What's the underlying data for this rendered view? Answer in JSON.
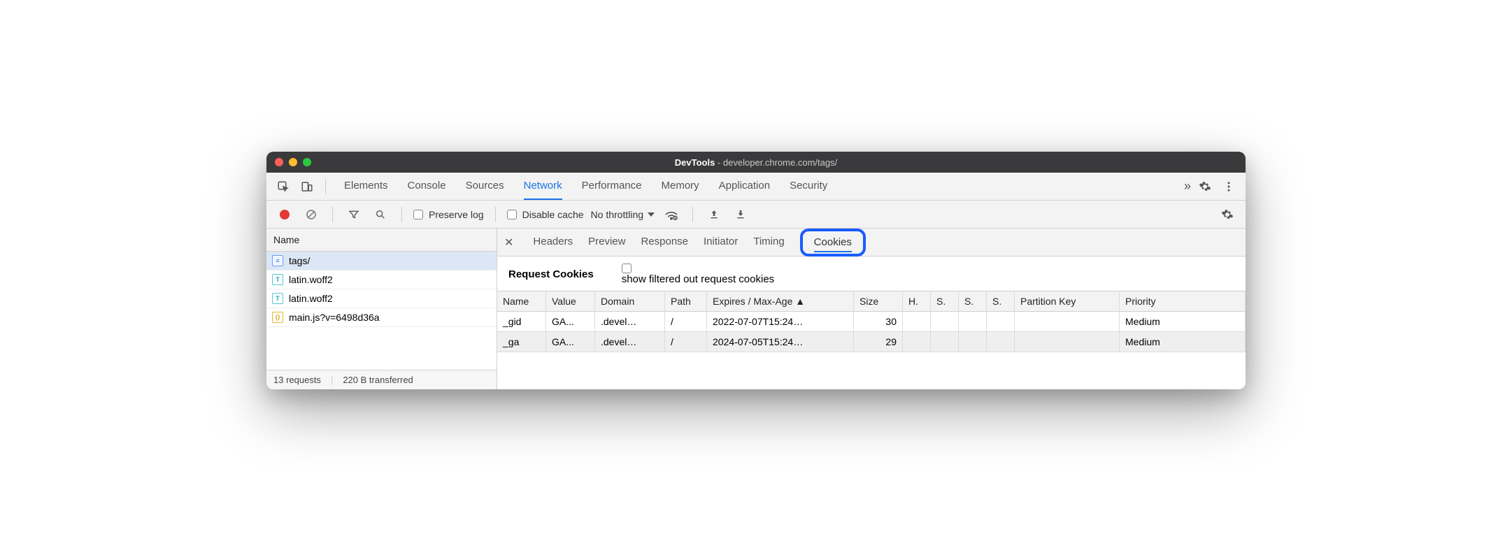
{
  "window": {
    "title_prefix": "DevTools",
    "title_url": "developer.chrome.com/tags/"
  },
  "main_tabs": [
    "Elements",
    "Console",
    "Sources",
    "Network",
    "Performance",
    "Memory",
    "Application",
    "Security"
  ],
  "main_tab_active": "Network",
  "toolbar": {
    "preserve_log": "Preserve log",
    "disable_cache": "Disable cache",
    "throttling": "No throttling"
  },
  "sidebar": {
    "header": "Name",
    "items": [
      {
        "name": "tags/",
        "type": "doc",
        "selected": true
      },
      {
        "name": "latin.woff2",
        "type": "font"
      },
      {
        "name": "latin.woff2",
        "type": "font"
      },
      {
        "name": "main.js?v=6498d36a",
        "type": "js"
      }
    ],
    "status_requests": "13 requests",
    "status_transferred": "220 B transferred"
  },
  "detail_tabs": [
    "Headers",
    "Preview",
    "Response",
    "Initiator",
    "Timing",
    "Cookies"
  ],
  "detail_tab_active": "Cookies",
  "cookies_panel": {
    "heading": "Request Cookies",
    "filter_label": "show filtered out request cookies",
    "columns": [
      "Name",
      "Value",
      "Domain",
      "Path",
      "Expires / Max-Age ▲",
      "Size",
      "H.",
      "S.",
      "S.",
      "S.",
      "Partition Key",
      "Priority"
    ],
    "rows": [
      {
        "name": "_gid",
        "value": "GA...",
        "domain": ".devel…",
        "path": "/",
        "expires": "2022-07-07T15:24…",
        "size": "30",
        "h": "",
        "s1": "",
        "s2": "",
        "s3": "",
        "partition": "",
        "priority": "Medium"
      },
      {
        "name": "_ga",
        "value": "GA...",
        "domain": ".devel…",
        "path": "/",
        "expires": "2024-07-05T15:24…",
        "size": "29",
        "h": "",
        "s1": "",
        "s2": "",
        "s3": "",
        "partition": "",
        "priority": "Medium"
      }
    ]
  }
}
